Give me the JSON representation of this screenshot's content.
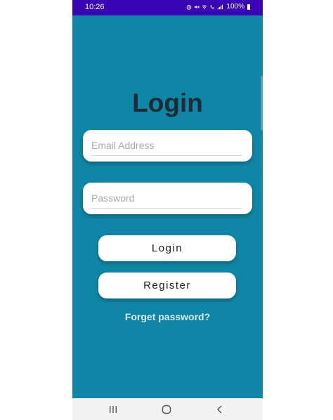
{
  "status_bar": {
    "time": "10:26",
    "battery_percent": "100%",
    "icons": [
      "alarm-icon",
      "mute-icon",
      "wifi-icon",
      "volte-icon",
      "signal-icon",
      "battery-icon"
    ]
  },
  "login_form": {
    "title": "Login",
    "email_placeholder": "Email Address",
    "email_value": "",
    "password_placeholder": "Password",
    "password_value": "",
    "login_label": "Login",
    "register_label": "Register",
    "forgot_label": "Forget password?"
  },
  "nav_bar": {
    "icons": [
      "recents-icon",
      "home-icon",
      "back-icon"
    ]
  },
  "colors": {
    "background": "#1086a6",
    "status_bar": "#3a06b5",
    "title_text": "#1f2a33",
    "field_bg": "#ffffff",
    "link_text": "#d8e8ee"
  }
}
